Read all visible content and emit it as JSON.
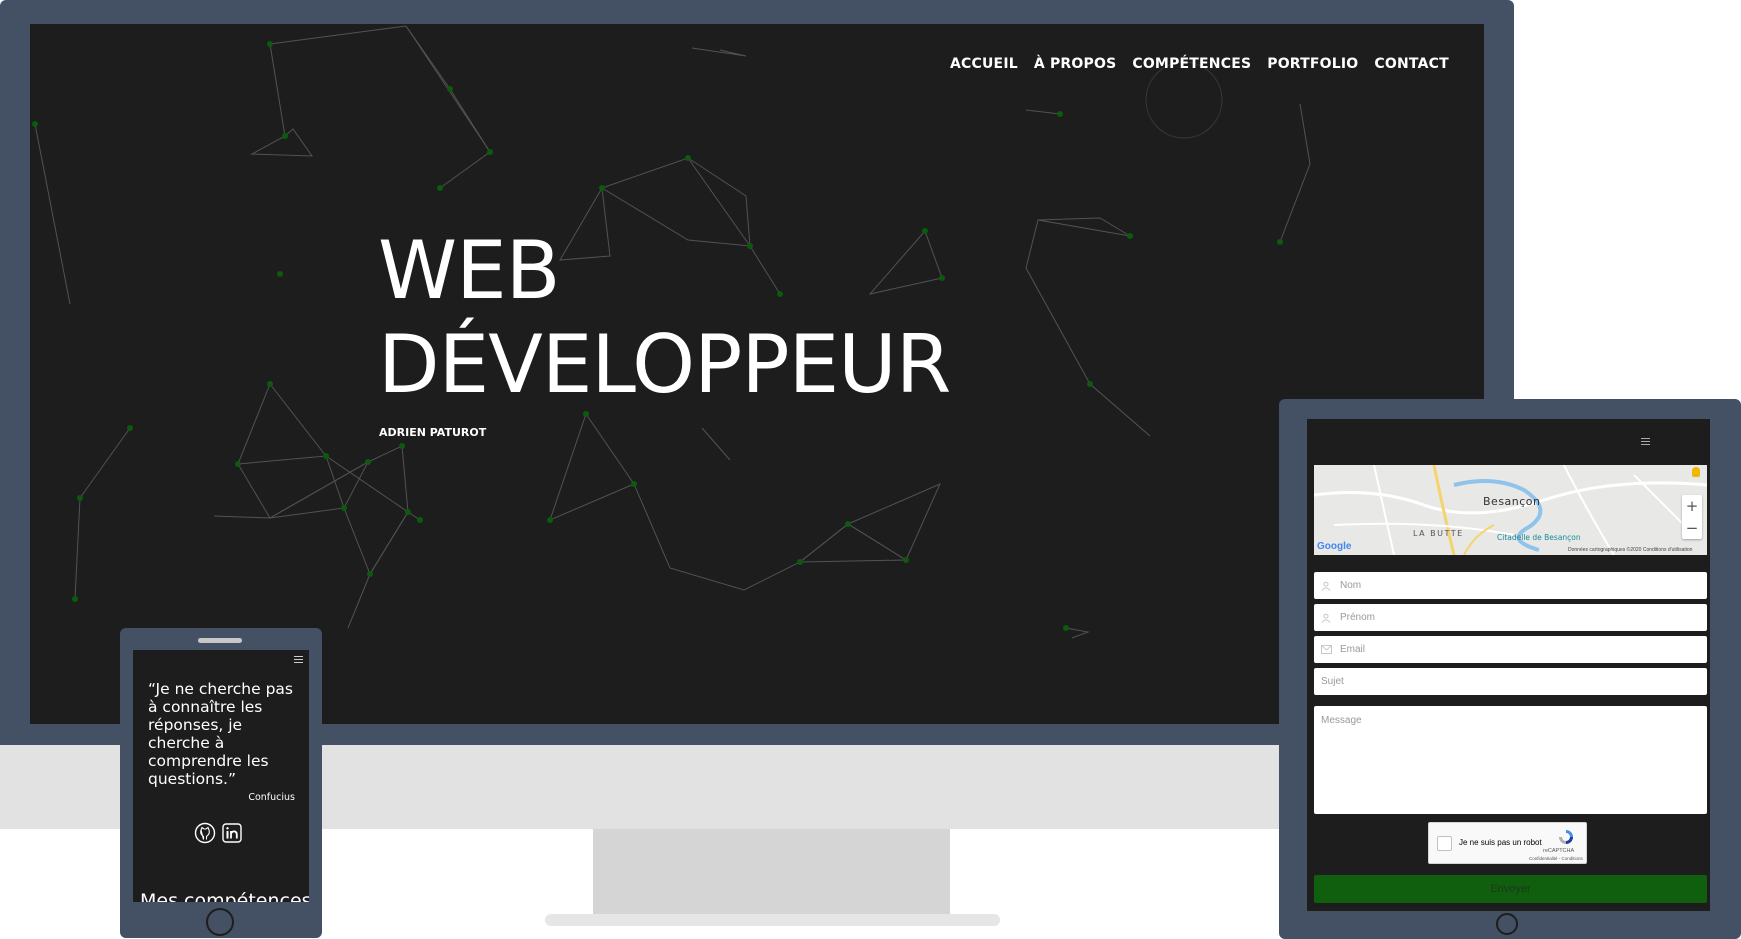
{
  "desktop": {
    "nav": [
      "ACCUEIL",
      "À PROPOS",
      "COMPÉTENCES",
      "PORTFOLIO",
      "CONTACT"
    ],
    "hero": {
      "title_line1": "WEB",
      "title_line2": "DÉVELOPPEUR",
      "subtitle": "ADRIEN PATUROT"
    }
  },
  "phone": {
    "quote": "“Je ne cherche pas à connaître les réponses, je cherche à comprendre les questions.”",
    "author": "Confucius",
    "social_icons": [
      "github-icon",
      "linkedin-icon"
    ],
    "next_section_title": "Mes compétences"
  },
  "tablet": {
    "map": {
      "city": "Besançon",
      "district": "LA BUTTE",
      "poi": "Citadelle de Besançon",
      "logo": "Google",
      "attribution": "Données cartographiques ©2020   Conditions d'utilisation",
      "zoom_in": "+",
      "zoom_out": "−"
    },
    "form": {
      "nom": "Nom",
      "prenom": "Prénom",
      "email": "Email",
      "sujet": "Sujet",
      "message": "Message",
      "captcha_label": "Je ne suis pas un robot",
      "captcha_brand": "reCAPTCHA",
      "captcha_links": "Confidentialité - Conditions",
      "submit": "Envoyer"
    }
  },
  "colors": {
    "device_frame": "#445064",
    "screen_background": "#1d1d1d",
    "network_node": "#0c5a0c",
    "submit_button": "#0f5f0f"
  }
}
